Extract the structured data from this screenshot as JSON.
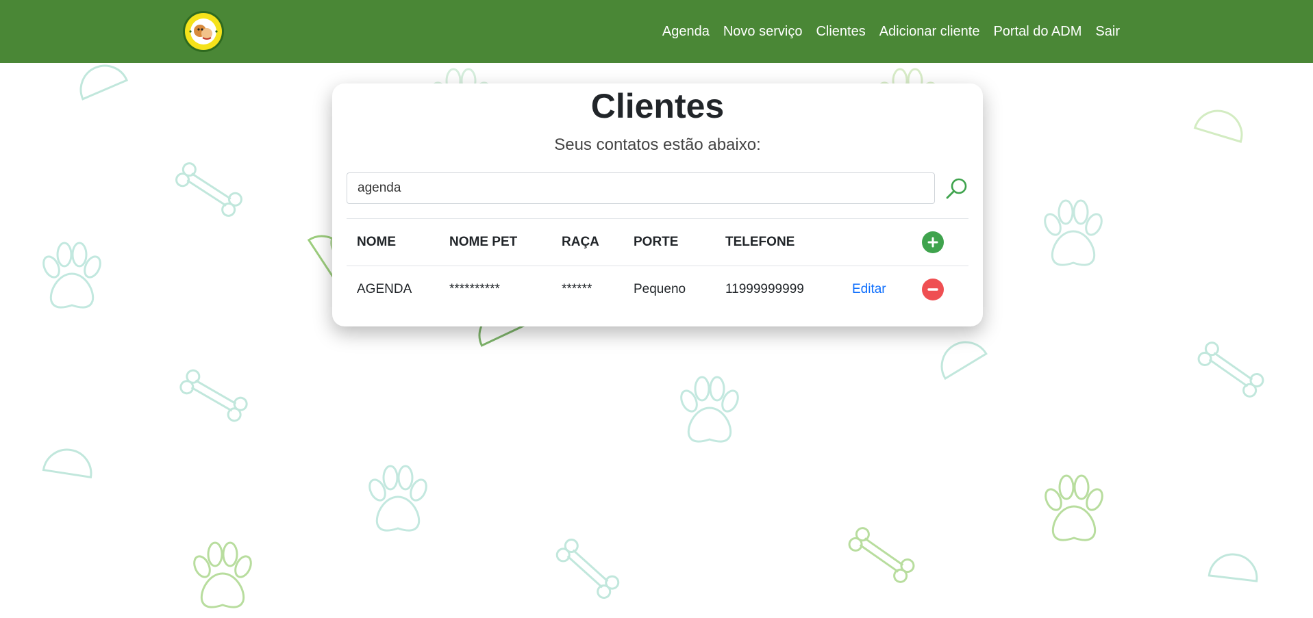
{
  "nav": {
    "brand_logo": "Viana Pet",
    "links": [
      "Agenda",
      "Novo serviço",
      "Clientes",
      "Adicionar cliente",
      "Portal do ADM",
      "Sair"
    ]
  },
  "page": {
    "title": "Clientes",
    "subtitle": "Seus contatos estão abaixo:"
  },
  "search": {
    "value": "agenda",
    "icon": "search-icon"
  },
  "table": {
    "headers": [
      "NOME",
      "NOME PET",
      "RAÇA",
      "PORTE",
      "TELEFONE"
    ],
    "rows": [
      {
        "nome": "AGENDA",
        "nome_pet": "**********",
        "raca": "******",
        "porte": "Pequeno",
        "telefone": "11999999999",
        "edit_label": "Editar"
      }
    ]
  },
  "colors": {
    "navbar": "#4a8736",
    "add": "#3fa34d",
    "remove": "#ef4f52",
    "link": "#0d6efd"
  }
}
